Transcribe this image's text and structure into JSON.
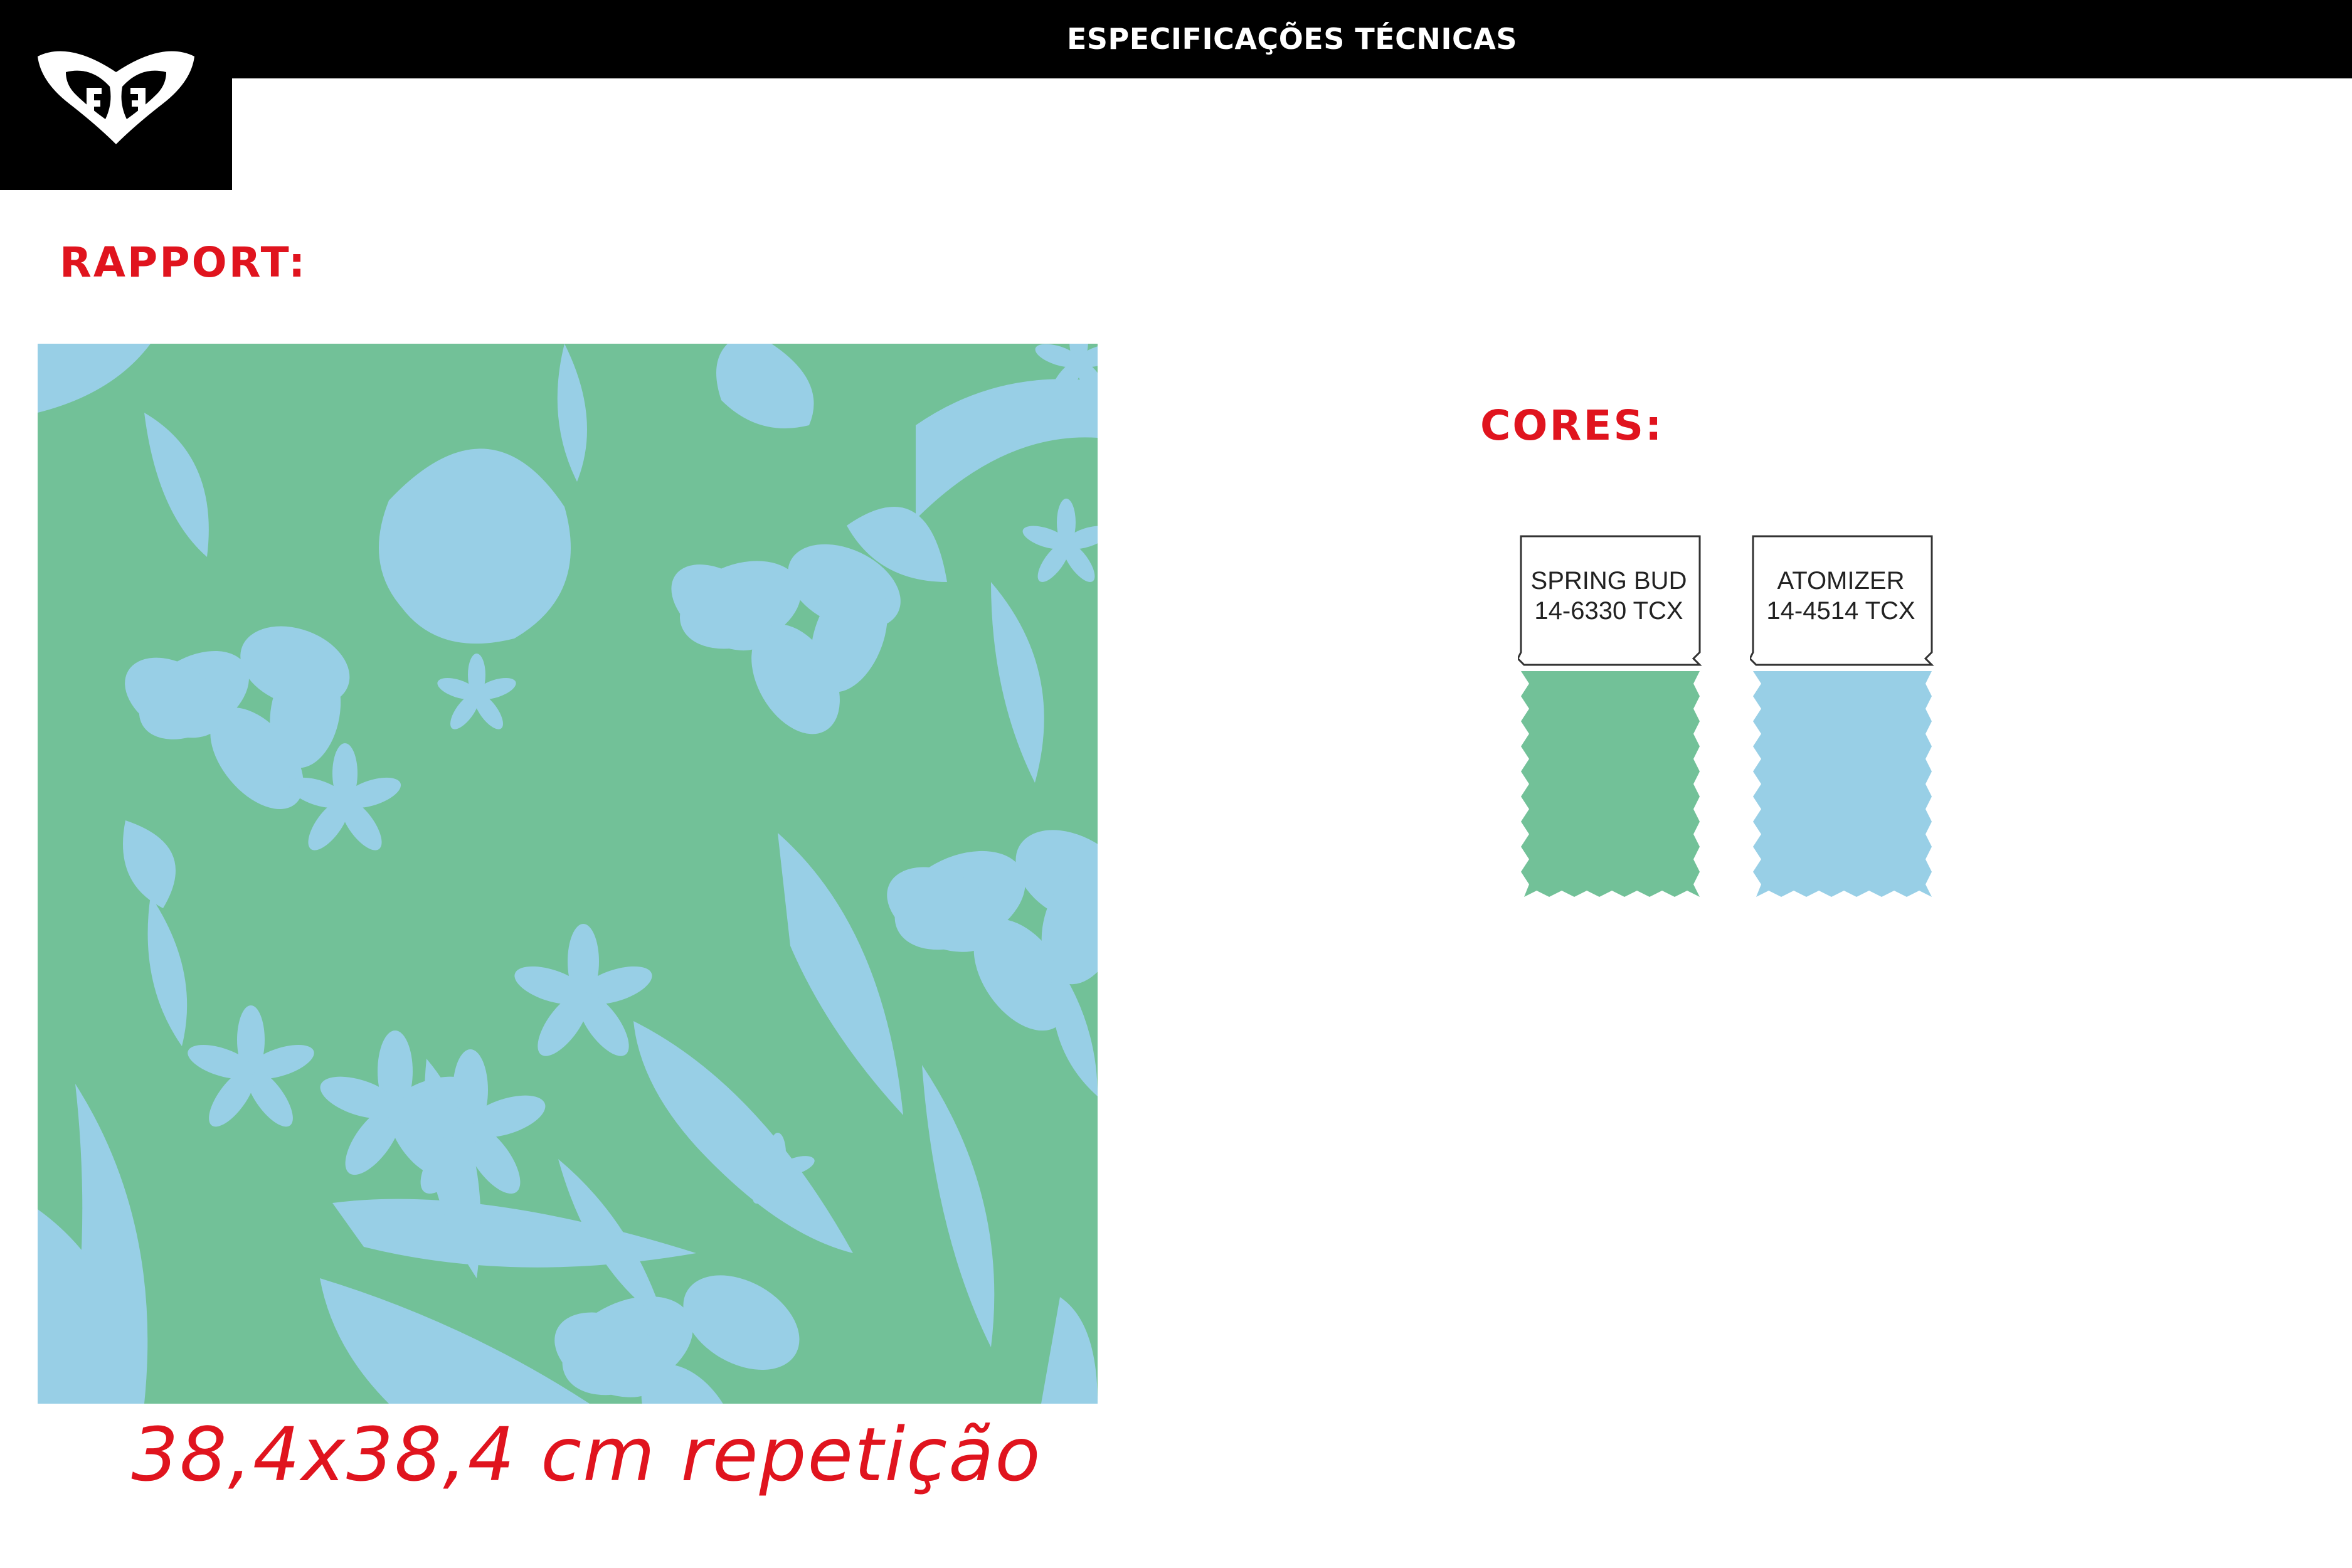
{
  "header": {
    "title": "ESPECIFICAÇÕES TÉCNICAS"
  },
  "logo": {
    "icon": "heart-logo-icon"
  },
  "rapport": {
    "label": "RAPPORT:"
  },
  "pattern": {
    "background_color": "#72c198",
    "motif_color": "#98cfe6",
    "repeat_caption": "38,4x38,4 cm repetição"
  },
  "cores": {
    "label": "CORES:",
    "swatches": [
      {
        "name": "SPRING BUD",
        "code": "14-6330 TCX",
        "color": "#72c198"
      },
      {
        "name": "ATOMIZER",
        "code": "14-4514 TCX",
        "color": "#98cfe6"
      }
    ]
  }
}
